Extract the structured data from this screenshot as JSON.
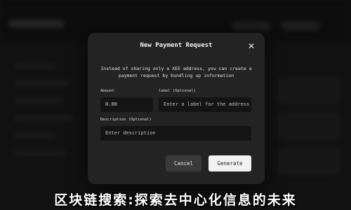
{
  "modal": {
    "title": "New Payment Request",
    "description": "Instead of sharing only a XEE address, you can create a payment request by bundling up information",
    "amount": {
      "label": "Amount",
      "value": "0.00"
    },
    "label_field": {
      "label": "label (Optional)",
      "placeholder": "Enter a label for the address"
    },
    "description_field": {
      "label": "Description (Optional)",
      "placeholder": "Enter description"
    },
    "cancel_label": "Cancel",
    "generate_label": "Generate",
    "close_icon": "close-icon"
  },
  "caption": "区块链搜索:探索去中心化信息的未来"
}
